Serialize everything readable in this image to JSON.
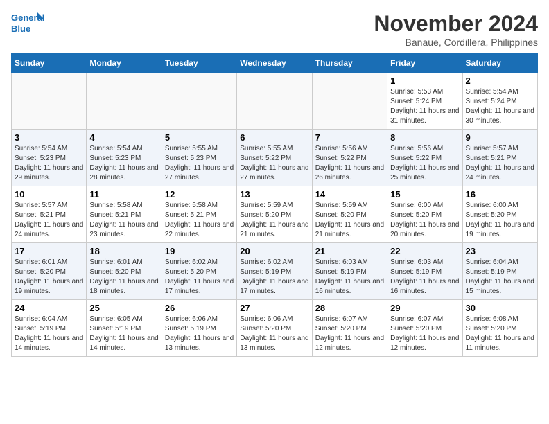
{
  "header": {
    "logo_line1": "General",
    "logo_line2": "Blue",
    "month_title": "November 2024",
    "location": "Banaue, Cordillera, Philippines"
  },
  "weekdays": [
    "Sunday",
    "Monday",
    "Tuesday",
    "Wednesday",
    "Thursday",
    "Friday",
    "Saturday"
  ],
  "weeks": [
    [
      {
        "day": "",
        "info": ""
      },
      {
        "day": "",
        "info": ""
      },
      {
        "day": "",
        "info": ""
      },
      {
        "day": "",
        "info": ""
      },
      {
        "day": "",
        "info": ""
      },
      {
        "day": "1",
        "info": "Sunrise: 5:53 AM\nSunset: 5:24 PM\nDaylight: 11 hours and 31 minutes."
      },
      {
        "day": "2",
        "info": "Sunrise: 5:54 AM\nSunset: 5:24 PM\nDaylight: 11 hours and 30 minutes."
      }
    ],
    [
      {
        "day": "3",
        "info": "Sunrise: 5:54 AM\nSunset: 5:23 PM\nDaylight: 11 hours and 29 minutes."
      },
      {
        "day": "4",
        "info": "Sunrise: 5:54 AM\nSunset: 5:23 PM\nDaylight: 11 hours and 28 minutes."
      },
      {
        "day": "5",
        "info": "Sunrise: 5:55 AM\nSunset: 5:23 PM\nDaylight: 11 hours and 27 minutes."
      },
      {
        "day": "6",
        "info": "Sunrise: 5:55 AM\nSunset: 5:22 PM\nDaylight: 11 hours and 27 minutes."
      },
      {
        "day": "7",
        "info": "Sunrise: 5:56 AM\nSunset: 5:22 PM\nDaylight: 11 hours and 26 minutes."
      },
      {
        "day": "8",
        "info": "Sunrise: 5:56 AM\nSunset: 5:22 PM\nDaylight: 11 hours and 25 minutes."
      },
      {
        "day": "9",
        "info": "Sunrise: 5:57 AM\nSunset: 5:21 PM\nDaylight: 11 hours and 24 minutes."
      }
    ],
    [
      {
        "day": "10",
        "info": "Sunrise: 5:57 AM\nSunset: 5:21 PM\nDaylight: 11 hours and 24 minutes."
      },
      {
        "day": "11",
        "info": "Sunrise: 5:58 AM\nSunset: 5:21 PM\nDaylight: 11 hours and 23 minutes."
      },
      {
        "day": "12",
        "info": "Sunrise: 5:58 AM\nSunset: 5:21 PM\nDaylight: 11 hours and 22 minutes."
      },
      {
        "day": "13",
        "info": "Sunrise: 5:59 AM\nSunset: 5:20 PM\nDaylight: 11 hours and 21 minutes."
      },
      {
        "day": "14",
        "info": "Sunrise: 5:59 AM\nSunset: 5:20 PM\nDaylight: 11 hours and 21 minutes."
      },
      {
        "day": "15",
        "info": "Sunrise: 6:00 AM\nSunset: 5:20 PM\nDaylight: 11 hours and 20 minutes."
      },
      {
        "day": "16",
        "info": "Sunrise: 6:00 AM\nSunset: 5:20 PM\nDaylight: 11 hours and 19 minutes."
      }
    ],
    [
      {
        "day": "17",
        "info": "Sunrise: 6:01 AM\nSunset: 5:20 PM\nDaylight: 11 hours and 19 minutes."
      },
      {
        "day": "18",
        "info": "Sunrise: 6:01 AM\nSunset: 5:20 PM\nDaylight: 11 hours and 18 minutes."
      },
      {
        "day": "19",
        "info": "Sunrise: 6:02 AM\nSunset: 5:20 PM\nDaylight: 11 hours and 17 minutes."
      },
      {
        "day": "20",
        "info": "Sunrise: 6:02 AM\nSunset: 5:19 PM\nDaylight: 11 hours and 17 minutes."
      },
      {
        "day": "21",
        "info": "Sunrise: 6:03 AM\nSunset: 5:19 PM\nDaylight: 11 hours and 16 minutes."
      },
      {
        "day": "22",
        "info": "Sunrise: 6:03 AM\nSunset: 5:19 PM\nDaylight: 11 hours and 16 minutes."
      },
      {
        "day": "23",
        "info": "Sunrise: 6:04 AM\nSunset: 5:19 PM\nDaylight: 11 hours and 15 minutes."
      }
    ],
    [
      {
        "day": "24",
        "info": "Sunrise: 6:04 AM\nSunset: 5:19 PM\nDaylight: 11 hours and 14 minutes."
      },
      {
        "day": "25",
        "info": "Sunrise: 6:05 AM\nSunset: 5:19 PM\nDaylight: 11 hours and 14 minutes."
      },
      {
        "day": "26",
        "info": "Sunrise: 6:06 AM\nSunset: 5:19 PM\nDaylight: 11 hours and 13 minutes."
      },
      {
        "day": "27",
        "info": "Sunrise: 6:06 AM\nSunset: 5:20 PM\nDaylight: 11 hours and 13 minutes."
      },
      {
        "day": "28",
        "info": "Sunrise: 6:07 AM\nSunset: 5:20 PM\nDaylight: 11 hours and 12 minutes."
      },
      {
        "day": "29",
        "info": "Sunrise: 6:07 AM\nSunset: 5:20 PM\nDaylight: 11 hours and 12 minutes."
      },
      {
        "day": "30",
        "info": "Sunrise: 6:08 AM\nSunset: 5:20 PM\nDaylight: 11 hours and 11 minutes."
      }
    ]
  ]
}
